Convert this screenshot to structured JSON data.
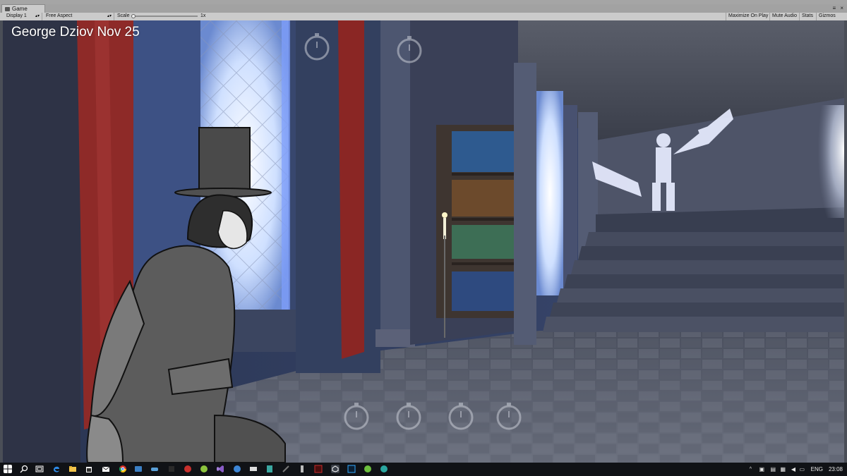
{
  "editor": {
    "tab_title": "Game",
    "window_controls": "≡ ×"
  },
  "toolbar": {
    "display": "Display 1",
    "aspect": "Free Aspect",
    "scale_label": "Scale",
    "scale_value": "1x",
    "maximize_on_play": "Maximize On Play",
    "mute_audio": "Mute Audio",
    "stats": "Stats",
    "gizmos": "Gizmos"
  },
  "game_view": {
    "overlay_text": "George Dziov Nov 25",
    "scene_description_icons": [
      "stopwatch-icon"
    ]
  },
  "taskbar": {
    "language": "ENG",
    "time": "23:08"
  },
  "colors": {
    "editor_bg": "#cbcbcb",
    "taskbar_bg": "#101216",
    "curtain_red": "#8e2a28",
    "window_glow": "#dbe6ff"
  }
}
